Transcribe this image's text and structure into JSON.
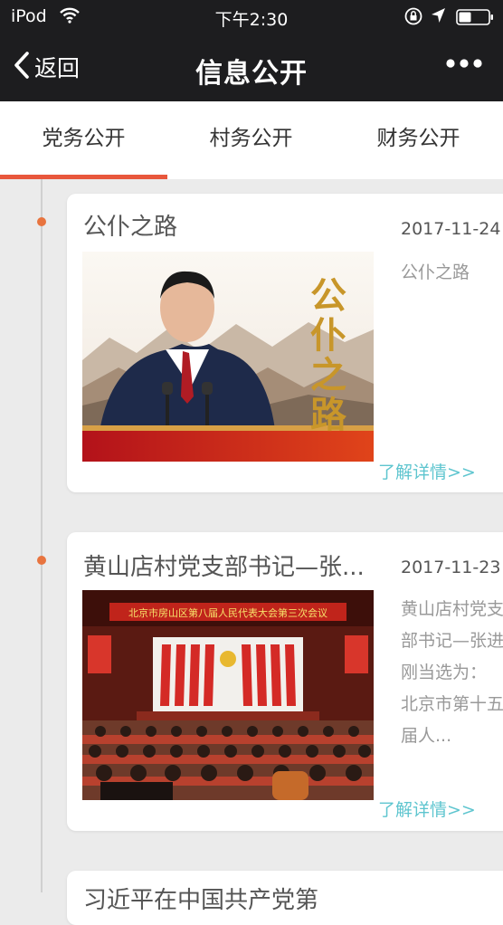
{
  "status": {
    "carrier": "iPod",
    "time": "下午2:30"
  },
  "nav": {
    "back_label": "返回",
    "title": "信息公开"
  },
  "tabs": [
    {
      "label": "党务公开",
      "active": true
    },
    {
      "label": "村务公开",
      "active": false
    },
    {
      "label": "财务公开",
      "active": false
    }
  ],
  "articles": [
    {
      "title": "公仆之路",
      "date": "2017-11-24",
      "summary": "公仆之路",
      "link": "了解详情>>",
      "image_text": "公仆之路"
    },
    {
      "title": "黄山店村党支部书记—张...",
      "date": "2017-11-23",
      "summary": "黄山店村党支部书记—张进刚当选为： 北京市第十五届人...",
      "link": "了解详情>>",
      "image_text": "北京市房山区第八届人民代表大会第三次会议"
    },
    {
      "title": "习近平在中国共产党第"
    }
  ],
  "colors": {
    "accent": "#e8573c",
    "link": "#5ec5cf",
    "bar": "#1d1d1f"
  }
}
